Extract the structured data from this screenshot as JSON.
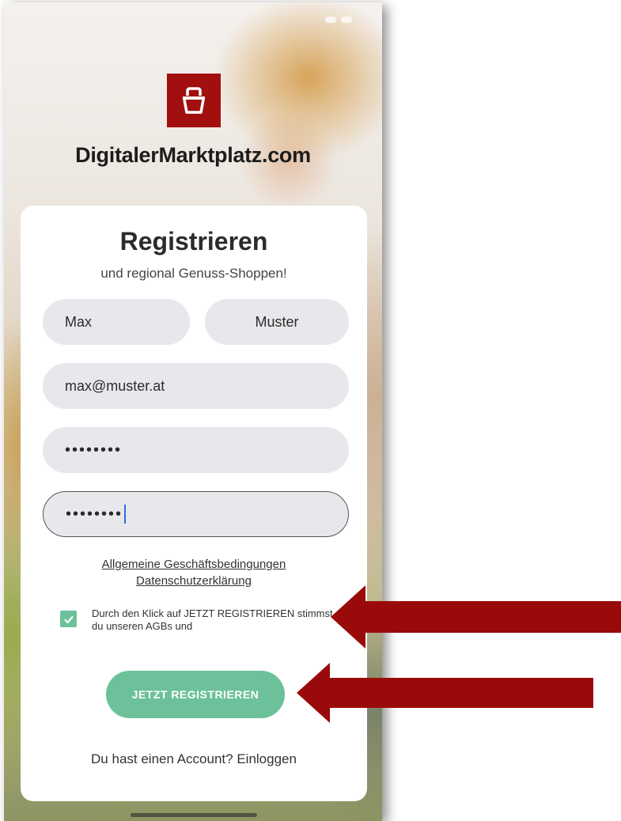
{
  "brand": {
    "name": "DigitalerMarktplatz.com",
    "logo_icon": "basket-icon",
    "logo_color": "#a10f0f"
  },
  "form": {
    "title": "Registrieren",
    "subtitle": "und regional Genuss-Shoppen!",
    "first_name_value": "Max",
    "last_name_value": "Muster",
    "email_value": "max@muster.at",
    "password_value": "••••••••",
    "password_confirm_value": "••••••••"
  },
  "links": {
    "terms": "Allgemeine Geschäftsbedingungen",
    "privacy": "Datenschutzerklärung"
  },
  "consent": {
    "checked": true,
    "text": "Durch den Klick auf JETZT REGISTRIEREN stimmst du unseren AGBs und"
  },
  "actions": {
    "register_label": "JETZT REGISTRIEREN",
    "login_prompt": "Du hast einen Account? Einloggen"
  },
  "colors": {
    "accent_green": "#6cc19a",
    "annotation_arrow": "#9b0a0a"
  }
}
